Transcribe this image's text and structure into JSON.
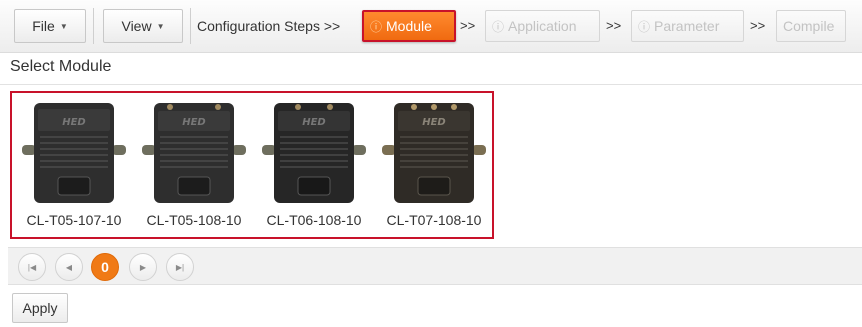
{
  "toolbar": {
    "file_label": "File",
    "view_label": "View",
    "steps_label": "Configuration Steps >>",
    "separator": ">>",
    "steps": [
      {
        "label": "Module",
        "icon": "exclamation-circle-icon",
        "state": "active"
      },
      {
        "label": "Application",
        "icon": "exclamation-circle-icon",
        "state": "disabled"
      },
      {
        "label": "Parameter",
        "icon": "exclamation-circle-icon",
        "state": "disabled"
      },
      {
        "label": "Compile",
        "state": "disabled"
      }
    ]
  },
  "section_title": "Select Module",
  "modules": [
    {
      "name": "CL-T05-107-10",
      "logo": "HED"
    },
    {
      "name": "CL-T05-108-10",
      "logo": "HED"
    },
    {
      "name": "CL-T06-108-10",
      "logo": "HED"
    },
    {
      "name": "CL-T07-108-10",
      "logo": "HED"
    }
  ],
  "pager": {
    "current_page": "0"
  },
  "apply_label": "Apply",
  "colors": {
    "accent": "#f07a16",
    "highlight_border": "#c8122a",
    "disabled_text": "#c3c3c3"
  }
}
